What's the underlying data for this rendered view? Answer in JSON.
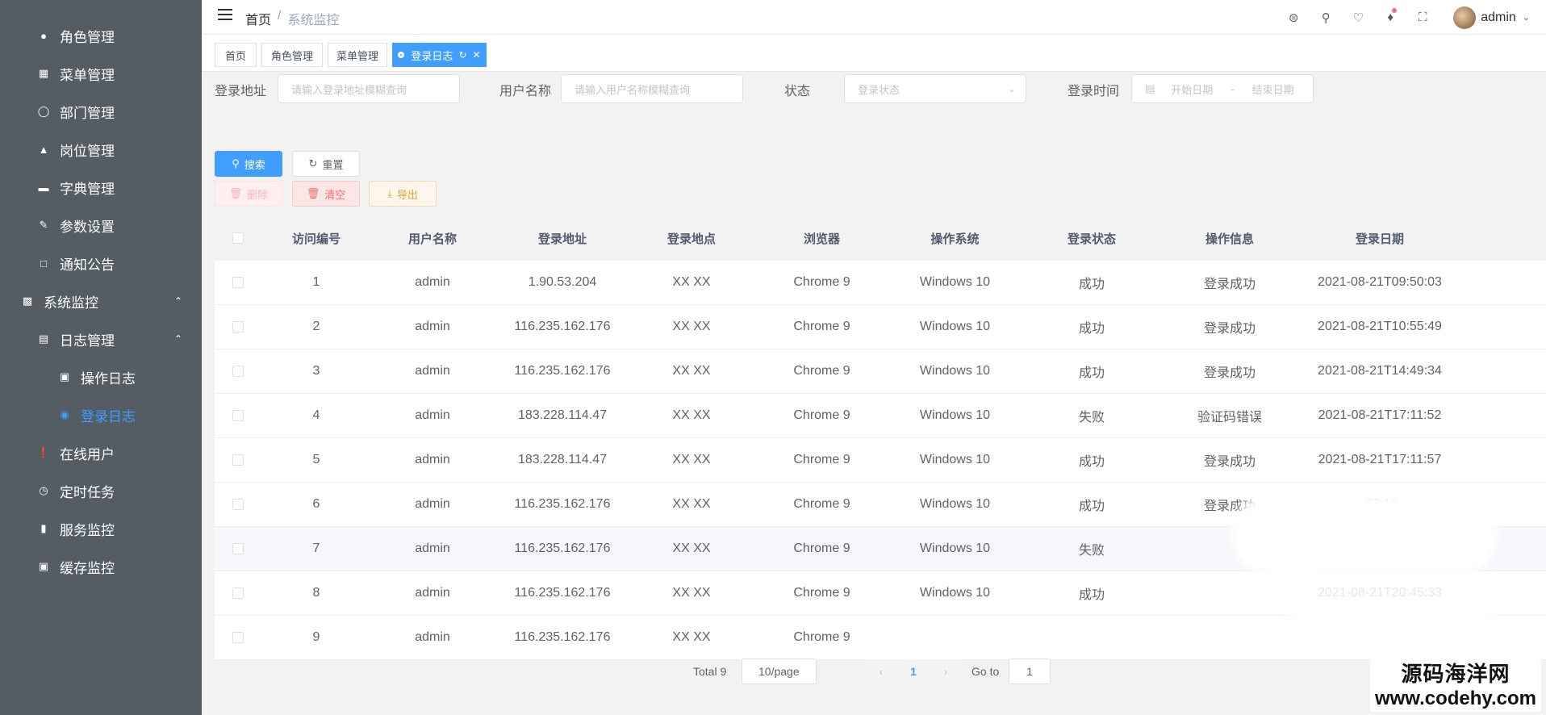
{
  "sidebar": {
    "items": [
      {
        "label": "角色管理",
        "icon": "user-icon"
      },
      {
        "label": "菜单管理",
        "icon": "grid-icon"
      },
      {
        "label": "部门管理",
        "icon": "person-icon"
      },
      {
        "label": "岗位管理",
        "icon": "post-icon"
      },
      {
        "label": "字典管理",
        "icon": "dict-icon"
      },
      {
        "label": "参数设置",
        "icon": "edit-icon"
      },
      {
        "label": "通知公告",
        "icon": "message-icon"
      },
      {
        "label": "系统监控",
        "icon": "monitor-icon"
      },
      {
        "label": "日志管理",
        "icon": "log-icon"
      },
      {
        "label": "操作日志",
        "icon": "form-icon"
      },
      {
        "label": "登录日志",
        "icon": "logininfor-icon"
      },
      {
        "label": "在线用户",
        "icon": "online-icon"
      },
      {
        "label": "定时任务",
        "icon": "clock-icon"
      },
      {
        "label": "服务监控",
        "icon": "chart-icon"
      },
      {
        "label": "缓存监控",
        "icon": "camera-icon"
      }
    ],
    "active_color": "#409eff"
  },
  "header": {
    "breadcrumb_home": "首页",
    "breadcrumb_sep": "/",
    "breadcrumb_current": "系统监控",
    "user": "admin"
  },
  "tags": [
    "首页",
    "角色管理",
    "菜单管理",
    "登录日志"
  ],
  "filters": {
    "addr_label": "登录地址",
    "addr_placeholder": "请输入登录地址模糊查询",
    "user_label": "用户名称",
    "user_placeholder": "请输入用户名称模糊查询",
    "status_label": "状态",
    "status_placeholder": "登录状态",
    "time_label": "登录时间",
    "date_start": "开始日期",
    "date_sep": "-",
    "date_end": "结束日期"
  },
  "buttons": {
    "search": "搜索",
    "reset": "重置",
    "delete": "删除",
    "clear": "清空",
    "export": "导出"
  },
  "table": {
    "columns": [
      "访问编号",
      "用户名称",
      "登录地址",
      "登录地点",
      "浏览器",
      "操作系统",
      "登录状态",
      "操作信息",
      "登录日期"
    ],
    "rows": [
      [
        "1",
        "admin",
        "1.90.53.204",
        "XX XX",
        "Chrome 9",
        "Windows 10",
        "成功",
        "登录成功",
        "2021-08-21T09:50:03"
      ],
      [
        "2",
        "admin",
        "116.235.162.176",
        "XX XX",
        "Chrome 9",
        "Windows 10",
        "成功",
        "登录成功",
        "2021-08-21T10:55:49"
      ],
      [
        "3",
        "admin",
        "116.235.162.176",
        "XX XX",
        "Chrome 9",
        "Windows 10",
        "成功",
        "登录成功",
        "2021-08-21T14:49:34"
      ],
      [
        "4",
        "admin",
        "183.228.114.47",
        "XX XX",
        "Chrome 9",
        "Windows 10",
        "失败",
        "验证码错误",
        "2021-08-21T17:11:52"
      ],
      [
        "5",
        "admin",
        "183.228.114.47",
        "XX XX",
        "Chrome 9",
        "Windows 10",
        "成功",
        "登录成功",
        "2021-08-21T17:11:57"
      ],
      [
        "6",
        "admin",
        "116.235.162.176",
        "XX XX",
        "Chrome 9",
        "Windows 10",
        "成功",
        "登录成功",
        ":33:19"
      ],
      [
        "7",
        "admin",
        "116.235.162.176",
        "XX XX",
        "Chrome 9",
        "Windows 10",
        "失败",
        "",
        "28"
      ],
      [
        "8",
        "admin",
        "116.235.162.176",
        "XX XX",
        "Chrome 9",
        "Windows 10",
        "成功",
        "",
        "2021-08-21T20:45:33"
      ],
      [
        "9",
        "admin",
        "116.235.162.176",
        "XX XX",
        "Chrome 9",
        "",
        "",
        "",
        ""
      ]
    ]
  },
  "pagination": {
    "total": "Total 9",
    "page_size": "10/page",
    "current": "1",
    "goto_label": "Go to",
    "goto_value": "1"
  },
  "watermark": {
    "cn": "源码海洋网",
    "url": "www.codehy.com"
  }
}
